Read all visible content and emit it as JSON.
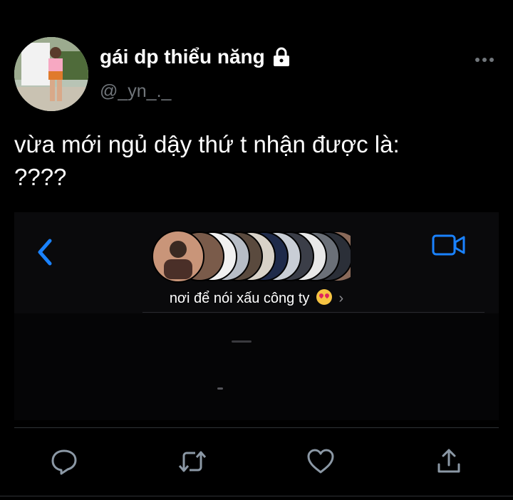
{
  "author": {
    "display_name": "gái dp thiểu năng",
    "handle": "@_yn_._"
  },
  "tweet": {
    "text": "vừa mới ngủ dậy thứ t nhận được là:\n????"
  },
  "media": {
    "group_name": "nơi để nói xấu công ty",
    "group_emoji": "heart-eyes-emoji",
    "chevron": "›"
  },
  "icons": {
    "more": "more-horizontal-icon",
    "lock": "lock-icon",
    "reply": "reply-icon",
    "retweet": "retweet-icon",
    "like": "like-icon",
    "share": "share-icon",
    "back": "back-chevron-icon",
    "video": "video-call-icon"
  },
  "colors": {
    "background": "#000000",
    "text": "#ffffff",
    "secondary": "#71767b",
    "ios_blue": "#1a82ff",
    "action_icon": "#8b98a5"
  }
}
